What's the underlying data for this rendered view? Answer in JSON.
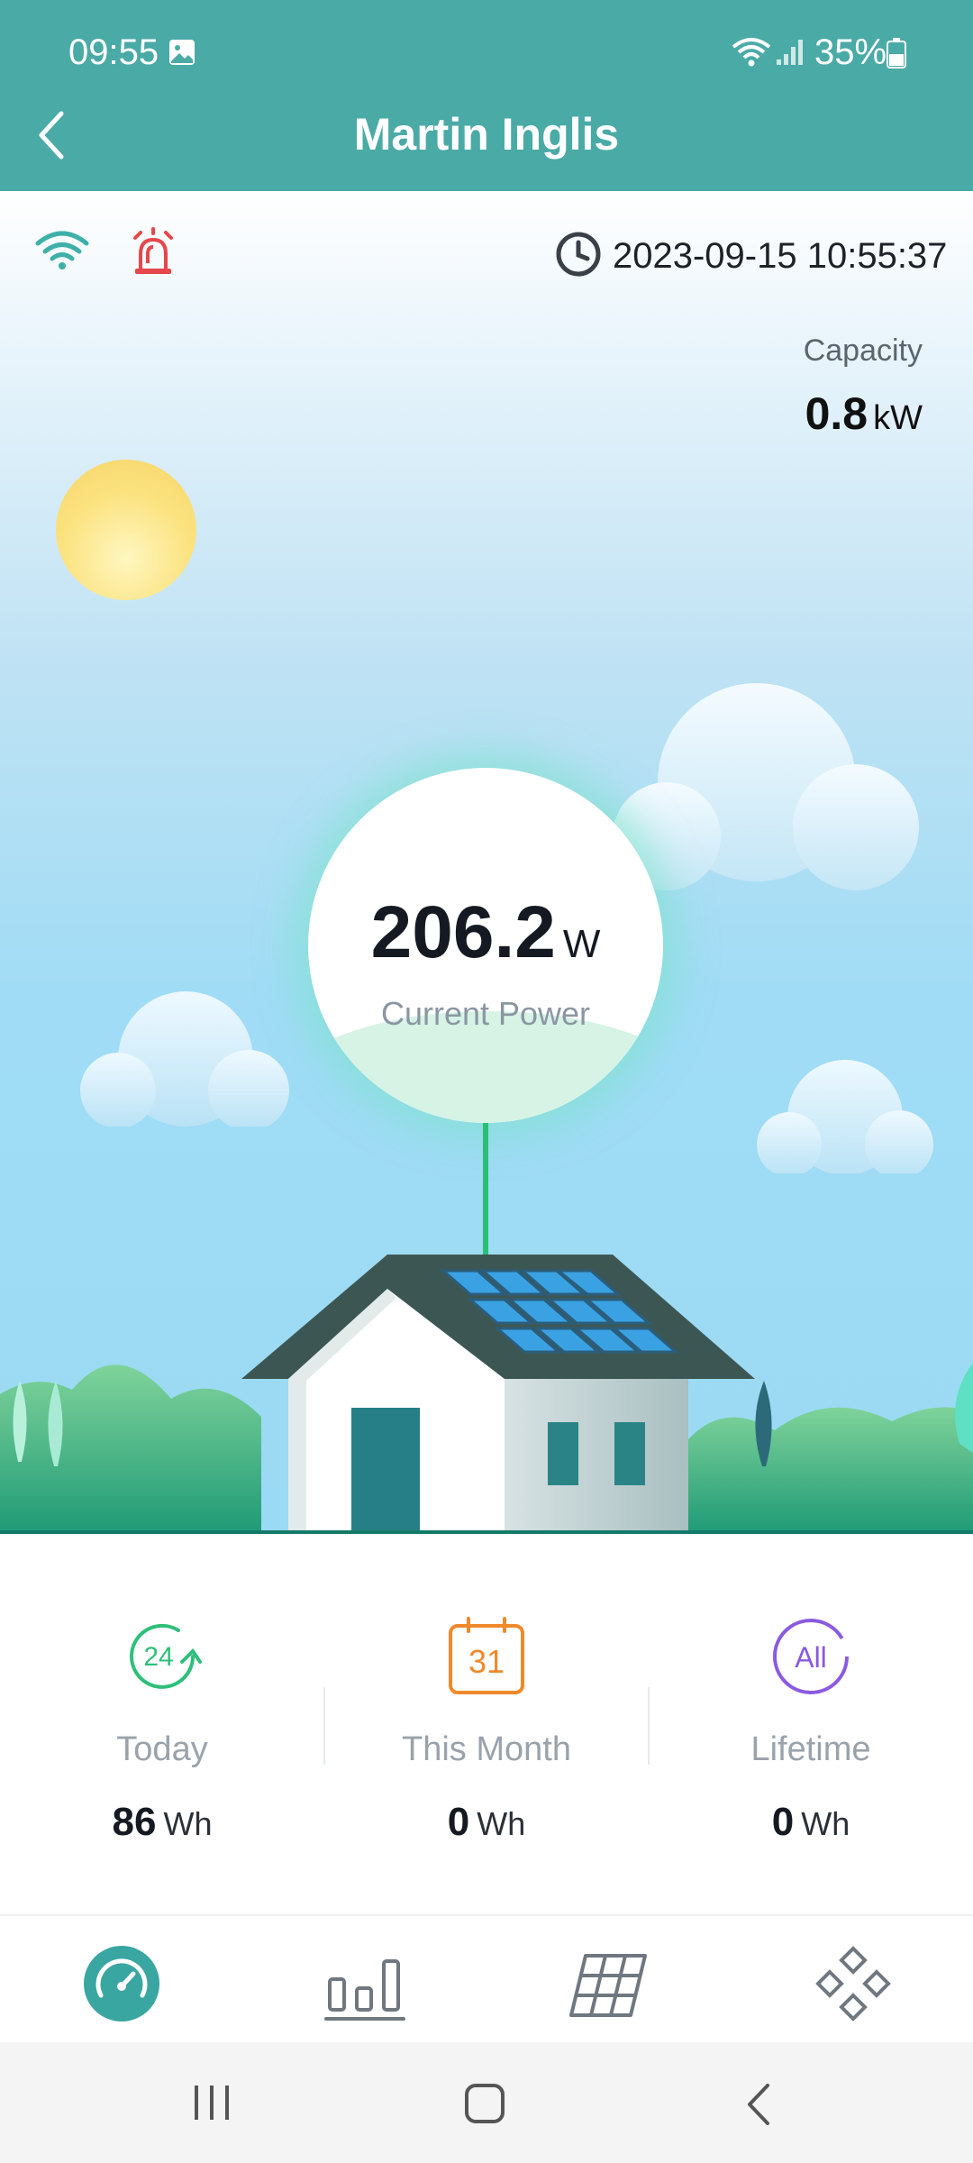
{
  "status_bar": {
    "time": "09:55",
    "battery": "35%"
  },
  "header": {
    "title": "Martin Inglis"
  },
  "device": {
    "timestamp": "2023-09-15 10:55:37",
    "capacity_label": "Capacity",
    "capacity_value": "0.8",
    "capacity_unit": "kW"
  },
  "power": {
    "value": "206.2",
    "unit": "W",
    "label": "Current Power"
  },
  "stats": [
    {
      "icon_text": "24",
      "label": "Today",
      "value": "86",
      "unit": "Wh",
      "color": "#2fbf7a"
    },
    {
      "icon_text": "31",
      "label": "This Month",
      "value": "0",
      "unit": "Wh",
      "color": "#f0892b"
    },
    {
      "icon_text": "All",
      "label": "Lifetime",
      "value": "0",
      "unit": "Wh",
      "color": "#8a5ae0"
    }
  ],
  "nav": {
    "items": [
      "gauge-icon",
      "bar-chart-icon",
      "solar-panel-icon",
      "devices-icon"
    ],
    "active": 0
  },
  "colors": {
    "header": "#4aaaa6",
    "accent": "#2bbf76",
    "alarm": "#e5474b"
  }
}
